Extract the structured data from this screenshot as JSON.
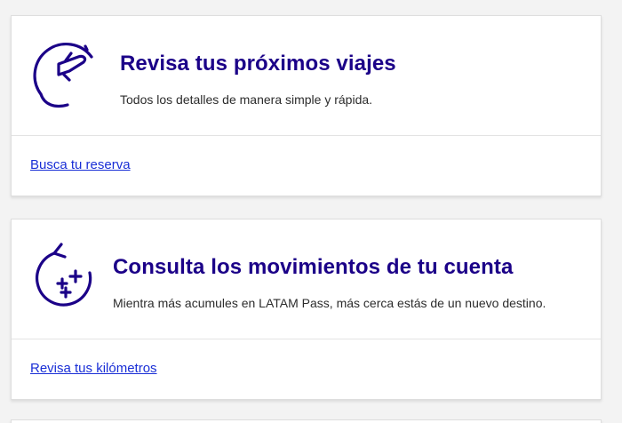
{
  "colors": {
    "brand": "#1b0088",
    "link": "#1a2fd6",
    "text": "#2c2c2c",
    "background": "#f3f3f3",
    "card": "#ffffff"
  },
  "cards": [
    {
      "icon": "plane-takeoff-icon",
      "title": "Revisa tus próximos viajes",
      "subtitle": "Todos los detalles de manera simple y rápida.",
      "link": "Busca tu reserva"
    },
    {
      "icon": "refresh-plus-icon",
      "title": "Consulta los movimientos de tu cuenta",
      "subtitle": "Mientra más acumules en LATAM Pass, más cerca estás de un nuevo destino.",
      "link": "Revisa tus kilómetros"
    }
  ]
}
